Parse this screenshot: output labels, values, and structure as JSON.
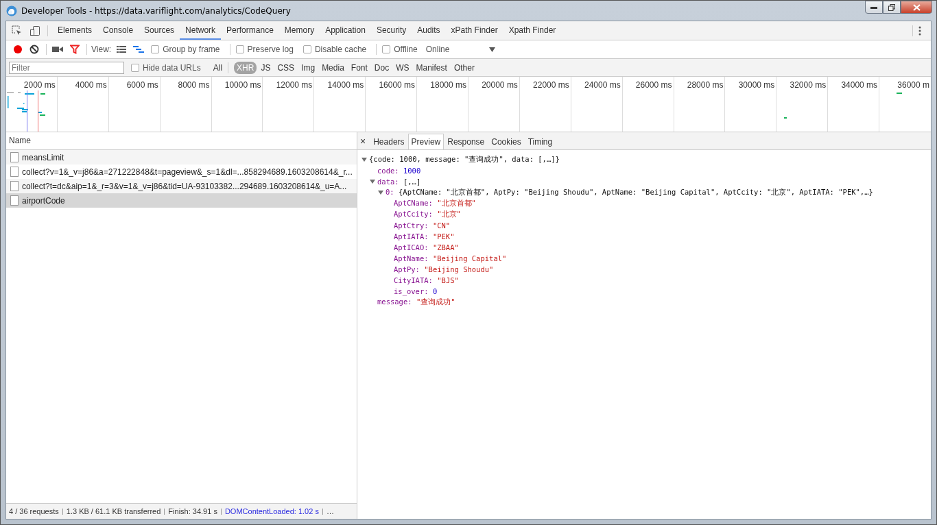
{
  "window": {
    "title": "Developer Tools - https://data.variflight.com/analytics/CodeQuery"
  },
  "main_tabs": [
    {
      "label": "Elements",
      "selected": false
    },
    {
      "label": "Console",
      "selected": false
    },
    {
      "label": "Sources",
      "selected": false
    },
    {
      "label": "Network",
      "selected": true
    },
    {
      "label": "Performance",
      "selected": false
    },
    {
      "label": "Memory",
      "selected": false
    },
    {
      "label": "Application",
      "selected": false
    },
    {
      "label": "Security",
      "selected": false
    },
    {
      "label": "Audits",
      "selected": false
    },
    {
      "label": "xPath Finder",
      "selected": false
    },
    {
      "label": "Xpath Finder",
      "selected": false
    }
  ],
  "toolbar": {
    "recording": true,
    "filter_active": true,
    "view_label": "View:",
    "options": [
      {
        "label": "Group by frame",
        "checked": false
      },
      {
        "label": "Preserve log",
        "checked": false
      },
      {
        "label": "Disable cache",
        "checked": false
      },
      {
        "label": "Offline",
        "checked": false
      }
    ],
    "throttling": "Online"
  },
  "filter_bar": {
    "placeholder": "Filter",
    "hide_data_urls": {
      "label": "Hide data URLs",
      "checked": false
    },
    "types": [
      {
        "label": "All",
        "selected": false
      },
      {
        "label": "XHR",
        "selected": true
      },
      {
        "label": "JS",
        "selected": false
      },
      {
        "label": "CSS",
        "selected": false
      },
      {
        "label": "Img",
        "selected": false
      },
      {
        "label": "Media",
        "selected": false
      },
      {
        "label": "Font",
        "selected": false
      },
      {
        "label": "Doc",
        "selected": false
      },
      {
        "label": "WS",
        "selected": false
      },
      {
        "label": "Manifest",
        "selected": false
      },
      {
        "label": "Other",
        "selected": false
      }
    ]
  },
  "timeline": {
    "ticks": [
      "2000 ms",
      "4000 ms",
      "6000 ms",
      "8000 ms",
      "10000 ms",
      "12000 ms",
      "14000 ms",
      "16000 ms",
      "18000 ms",
      "20000 ms",
      "22000 ms",
      "24000 ms",
      "26000 ms",
      "28000 ms",
      "30000 ms",
      "32000 ms",
      "34000 ms",
      "36000 m"
    ]
  },
  "requests": {
    "column": "Name",
    "rows": [
      {
        "name": "meansLimit",
        "selected": false
      },
      {
        "name": "collect?v=1&_v=j86&a=271222848&t=pageview&_s=1&dl=...858294689.1603208614&_r...",
        "selected": false
      },
      {
        "name": "collect?t=dc&aip=1&_r=3&v=1&_v=j86&tid=UA-93103382...294689.1603208614&_u=A...",
        "selected": false
      },
      {
        "name": "airportCode",
        "selected": true
      }
    ]
  },
  "detail": {
    "close": "×",
    "tabs": [
      {
        "label": "Headers",
        "selected": false
      },
      {
        "label": "Preview",
        "selected": true
      },
      {
        "label": "Response",
        "selected": false
      },
      {
        "label": "Cookies",
        "selected": false
      },
      {
        "label": "Timing",
        "selected": false
      }
    ],
    "preview": {
      "value": "{code: 1000, message: \"查询成功\", data: [,…]}",
      "kind": "summary",
      "expanded": true,
      "children": [
        {
          "key": "code:",
          "value": "1000",
          "kind": "number"
        },
        {
          "key": "data:",
          "value": "[,…]",
          "kind": "summary",
          "expanded": true,
          "children": [
            {
              "key": "0:",
              "value": "{AptCName: \"北京首都\", AptPy: \"Beijing Shoudu\", AptName: \"Beijing Capital\", AptCcity: \"北京\", AptIATA: \"PEK\",…}",
              "kind": "summary",
              "expanded": true,
              "children": [
                {
                  "key": "AptCName:",
                  "value": "\"北京首都\"",
                  "kind": "string"
                },
                {
                  "key": "AptCcity:",
                  "value": "\"北京\"",
                  "kind": "string"
                },
                {
                  "key": "AptCtry:",
                  "value": "\"CN\"",
                  "kind": "string"
                },
                {
                  "key": "AptIATA:",
                  "value": "\"PEK\"",
                  "kind": "string"
                },
                {
                  "key": "AptICAO:",
                  "value": "\"ZBAA\"",
                  "kind": "string"
                },
                {
                  "key": "AptName:",
                  "value": "\"Beijing Capital\"",
                  "kind": "string"
                },
                {
                  "key": "AptPy:",
                  "value": "\"Beijing Shoudu\"",
                  "kind": "string"
                },
                {
                  "key": "CityIATA:",
                  "value": "\"BJS\"",
                  "kind": "string"
                },
                {
                  "key": "is_over:",
                  "value": "0",
                  "kind": "number"
                }
              ]
            }
          ]
        },
        {
          "key": "message:",
          "value": "\"查询成功\"",
          "kind": "string"
        }
      ]
    }
  },
  "status_bar": [
    {
      "text": "4 / 36 requests",
      "kind": "plain"
    },
    {
      "text": "1.3 KB / 61.1 KB transferred",
      "kind": "plain"
    },
    {
      "text": "Finish: 34.91 s",
      "kind": "plain"
    },
    {
      "text": "DOMContentLoaded: 1.02 s",
      "kind": "link"
    },
    {
      "text": "…",
      "kind": "plain"
    }
  ]
}
